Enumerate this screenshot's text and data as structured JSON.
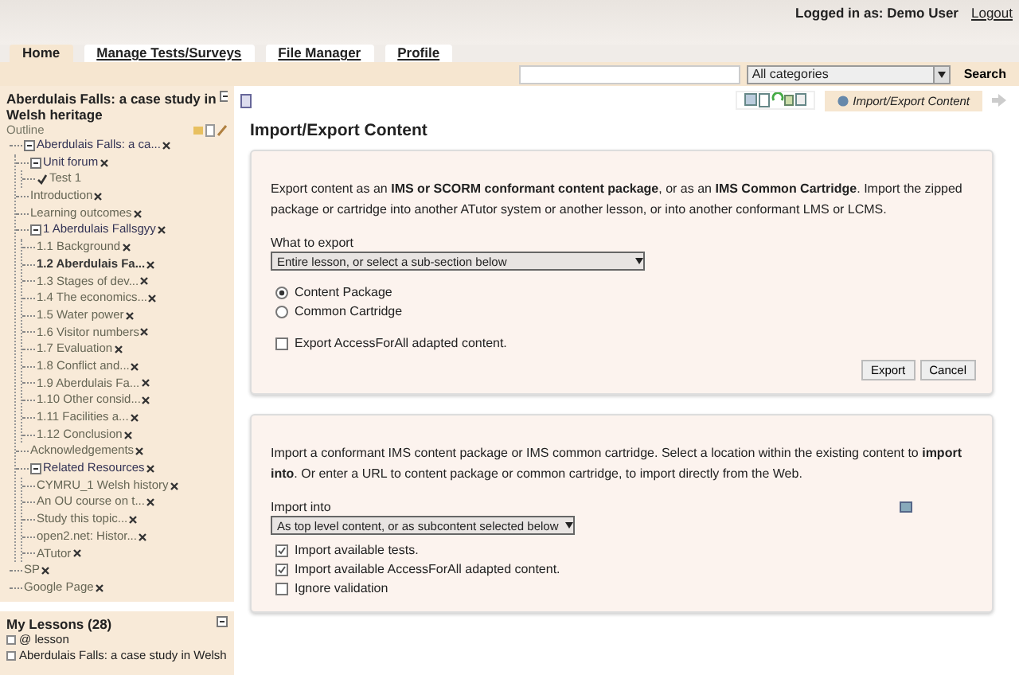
{
  "header": {
    "logged_in": "Logged in as: Demo User",
    "logout": "Logout"
  },
  "tabs": [
    {
      "label": "Home",
      "selected": true
    },
    {
      "label": "Manage Tests/Surveys",
      "selected": false
    },
    {
      "label": "File Manager",
      "selected": false
    },
    {
      "label": "Profile",
      "selected": false
    }
  ],
  "search": {
    "category": "All categories",
    "button": "Search"
  },
  "sidebar": {
    "course_title": "Aberdulais Falls: a case study in Welsh heritage",
    "outline_label": "Outline",
    "outline": [
      {
        "kind": "folder",
        "label": "Aberdulais Falls: a ca...",
        "expanded": true,
        "current": false,
        "children": [
          {
            "kind": "folder",
            "label": "Unit forum",
            "expanded": true,
            "current": false,
            "children": [
              {
                "kind": "test",
                "label": "Test 1",
                "current": false
              }
            ]
          },
          {
            "kind": "page",
            "label": "Introduction",
            "current": false
          },
          {
            "kind": "page",
            "label": "Learning outcomes",
            "current": false
          },
          {
            "kind": "folder",
            "label": "1 Aberdulais Fallsgyy",
            "expanded": true,
            "current": false,
            "children": [
              {
                "kind": "page",
                "label": "1.1 Background",
                "current": false
              },
              {
                "kind": "page",
                "label": "1.2 Aberdulais Fa...",
                "current": true
              },
              {
                "kind": "page",
                "label": "1.3 Stages of dev...",
                "current": false
              },
              {
                "kind": "page",
                "label": "1.4 The economics...",
                "current": false
              },
              {
                "kind": "page",
                "label": "1.5 Water power",
                "current": false
              },
              {
                "kind": "page",
                "label": "1.6 Visitor numbers",
                "current": false
              },
              {
                "kind": "page",
                "label": "1.7 Evaluation",
                "current": false
              },
              {
                "kind": "page",
                "label": "1.8 Conflict and...",
                "current": false
              },
              {
                "kind": "page",
                "label": "1.9 Aberdulais Fa...",
                "current": false
              },
              {
                "kind": "page",
                "label": "1.10 Other consid...",
                "current": false
              },
              {
                "kind": "page",
                "label": "1.11 Facilities a...",
                "current": false
              },
              {
                "kind": "page",
                "label": "1.12 Conclusion",
                "current": false
              }
            ]
          },
          {
            "kind": "page",
            "label": "Acknowledgements",
            "current": false
          },
          {
            "kind": "folder",
            "label": "Related Resources",
            "expanded": true,
            "current": false,
            "children": [
              {
                "kind": "page",
                "label": "CYMRU_1 Welsh history",
                "current": false
              },
              {
                "kind": "page",
                "label": "An OU course on t...",
                "current": false
              },
              {
                "kind": "page",
                "label": "Study this topic...",
                "current": false
              },
              {
                "kind": "page",
                "label": "open2.net: Histor...",
                "current": false
              },
              {
                "kind": "page",
                "label": "ATutor",
                "current": false
              }
            ]
          }
        ]
      },
      {
        "kind": "page",
        "label": "SP",
        "current": false
      },
      {
        "kind": "page",
        "label": "Google Page",
        "current": false
      }
    ],
    "my_lessons": {
      "title": "My Lessons (28)",
      "items": [
        "@ lesson",
        "Aberdulais Falls: a case study in Welsh"
      ]
    }
  },
  "toolbar": {
    "active_tool": "Import/Export Content"
  },
  "page_title": "Import/Export Content",
  "export_panel": {
    "intro": "Export content as an **IMS or SCORM conformant content package**, or as an **IMS Common Cartridge**. Import the zipped package or cartridge into another ATutor system or another lesson, or into another conformant LMS or LCMS.",
    "select_label": "What to export",
    "select_value": "Entire lesson, or select a sub-section below",
    "formats": [
      {
        "label": "Content Package",
        "selected": true
      },
      {
        "label": "Common Cartridge",
        "selected": false
      }
    ],
    "options": [
      {
        "label": "Export AccessForAll adapted content.",
        "checked": false
      }
    ],
    "buttons": [
      "Export",
      "Cancel"
    ]
  },
  "import_panel": {
    "intro": "Import a conformant IMS content package or IMS common cartridge. Select a location within the existing content to **import into**. Or enter a URL to content package or common cartridge, to import directly from the Web.",
    "select_label": "Import into",
    "select_value": "As top level content, or as subcontent selected below",
    "options": [
      {
        "label": "Import available tests.",
        "checked": true
      },
      {
        "label": "Import available AccessForAll adapted content.",
        "checked": true
      },
      {
        "label": "Ignore validation",
        "checked": false
      }
    ]
  }
}
